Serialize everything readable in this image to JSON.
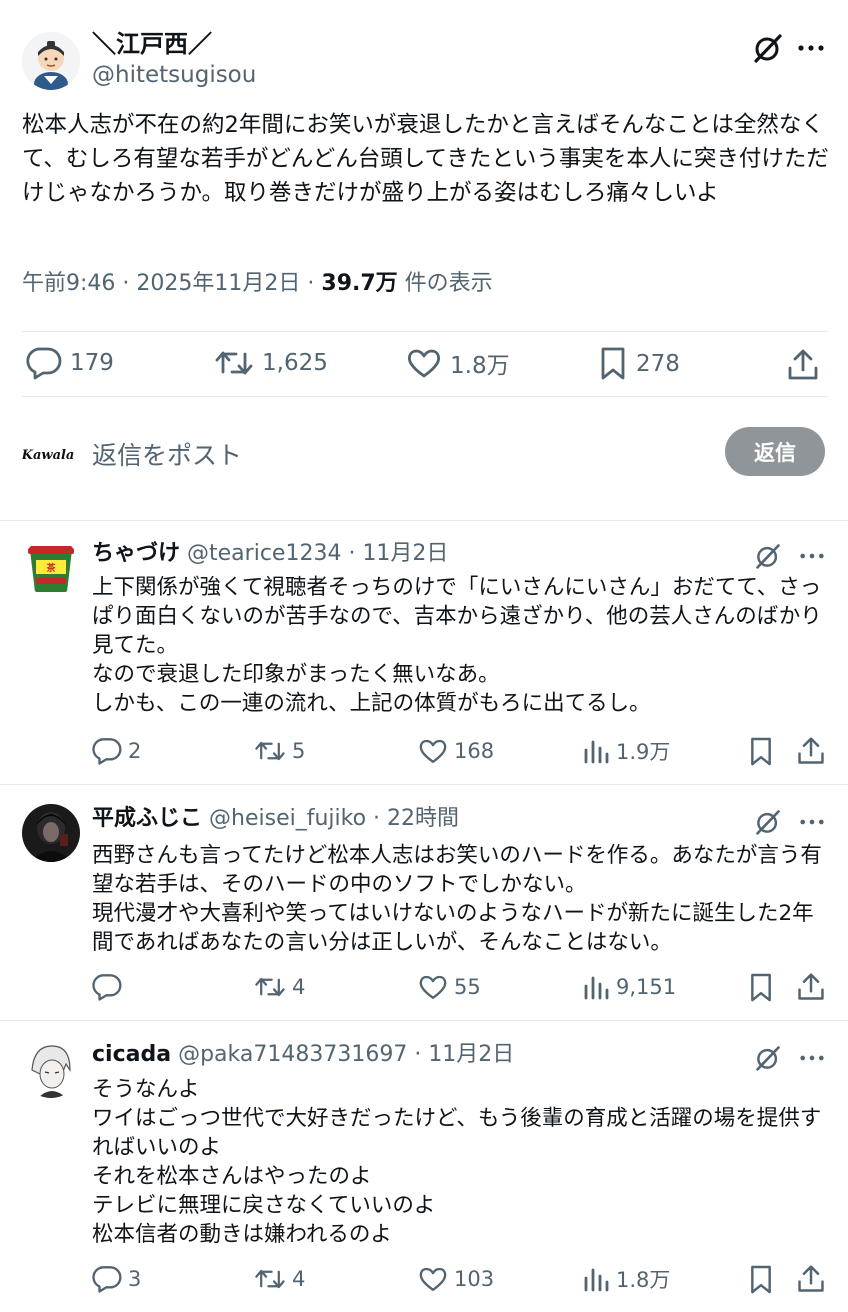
{
  "main_post": {
    "display_name": "＼江戸西／",
    "handle": "@hitetsugisou",
    "text": "松本人志が不在の約2年間にお笑いが衰退したかと言えばそんなことは全然なくて、むしろ有望な若手がどんどん台頭してきたという事実を本人に突き付けただけじゃなかろうか。取り巻きだけが盛り上がる姿はむしろ痛々しいよ",
    "time": "午前9:46",
    "date": "2025年11月2日",
    "views": "39.7万",
    "views_label": "件の表示",
    "replies": "179",
    "reposts": "1,625",
    "likes": "1.8万",
    "bookmarks": "278"
  },
  "reply_box": {
    "avatar_text": "Kawala",
    "placeholder": "返信をポスト",
    "button_label": "返信"
  },
  "comments": [
    {
      "name": "ちゃづけ",
      "handle": "@tearice1234",
      "time": "11月2日",
      "text": "上下関係が強くて視聴者そっちのけで「にいさんにいさん」おだてて、さっぱり面白くないのが苦手なので、吉本から遠ざかり、他の芸人さんのばかり見てた。\nなので衰退した印象がまったく無いなあ。\nしかも、この一連の流れ、上記の体質がもろに出てるし。",
      "replies": "2",
      "reposts": "5",
      "likes": "168",
      "views": "1.9万"
    },
    {
      "name": "平成ふじこ",
      "handle": "@heisei_fujiko",
      "time": "22時間",
      "text": "西野さんも言ってたけど松本人志はお笑いのハードを作る。あなたが言う有望な若手は、そのハードの中のソフトでしかない。\n現代漫才や大喜利や笑ってはいけないのようなハードが新たに誕生した2年間であればあなたの言い分は正しいが、そんなことはない。",
      "replies": "",
      "reposts": "4",
      "likes": "55",
      "views": "9,151"
    },
    {
      "name": "cicada",
      "handle": "@paka71483731697",
      "time": "11月2日",
      "text": "そうなんよ\nワイはごっつ世代で大好きだったけど、もう後輩の育成と活躍の場を提供すればいいのよ\nそれを松本さんはやったのよ\nテレビに無理に戻さなくていいのよ\n松本信者の動きは嫌われるのよ",
      "replies": "3",
      "reposts": "4",
      "likes": "103",
      "views": "1.8万"
    }
  ],
  "colors": {
    "text": "#0f1419",
    "secondary": "#536471",
    "divider": "#e6e9ec",
    "reply_button": "#8f9599"
  },
  "icons": [
    "grok-icon",
    "more-icon",
    "reply-icon",
    "repost-icon",
    "like-icon",
    "bookmark-icon",
    "share-icon",
    "views-icon"
  ]
}
